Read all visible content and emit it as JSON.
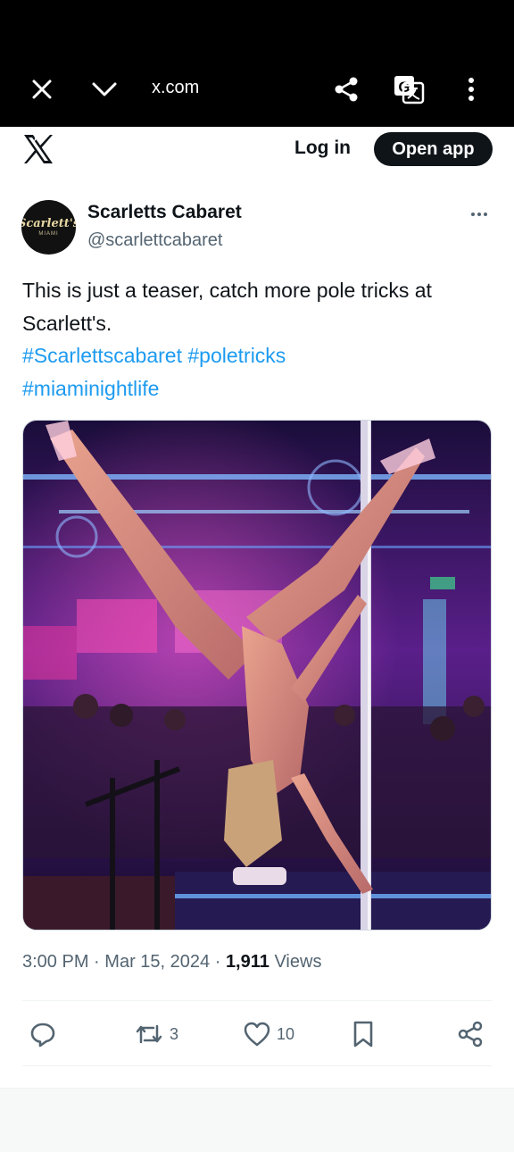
{
  "browser": {
    "url": "x.com",
    "icons": [
      "close-icon",
      "chevron-down-icon",
      "share-icon",
      "translate-icon",
      "more-vertical-icon"
    ]
  },
  "header": {
    "login_label": "Log in",
    "open_app_label": "Open app"
  },
  "post": {
    "avatar": {
      "brand": "Scarlett's",
      "sub": "MIAMI"
    },
    "display_name": "Scarletts Cabaret",
    "handle": "@scarlettcabaret",
    "text": "This is just a teaser, catch more pole tricks at Scarlett's.",
    "hashtags": [
      "#Scarlettscabaret",
      "#poletricks",
      "#miaminightlife"
    ],
    "time": "3:00 PM",
    "date": "Mar 15, 2024",
    "views_count": "1,911",
    "views_label": "Views",
    "dot": "·",
    "actions": {
      "replies": "",
      "reposts": "3",
      "likes": "10"
    }
  },
  "colors": {
    "accent": "#1d9bf0",
    "text": "#0f1419",
    "secondary": "#536471"
  }
}
